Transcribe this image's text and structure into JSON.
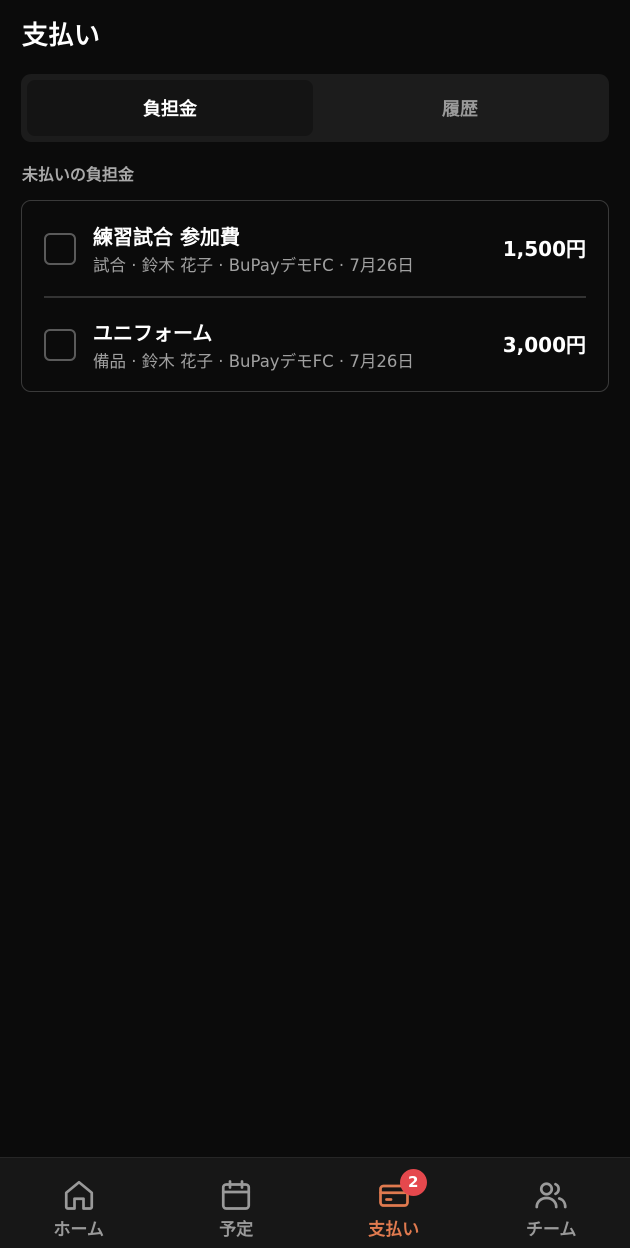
{
  "header": {
    "title": "支払い"
  },
  "tabs": [
    {
      "label": "負担金",
      "active": true
    },
    {
      "label": "履歴",
      "active": false
    }
  ],
  "section": {
    "label": "未払いの負担金"
  },
  "items": [
    {
      "title": "練習試合 参加費",
      "meta": "試合 · 鈴木 花子 · BuPayデモFC · 7月26日",
      "amount": "1,500円",
      "checked": false
    },
    {
      "title": "ユニフォーム",
      "meta": "備品 · 鈴木 花子 · BuPayデモFC · 7月26日",
      "amount": "3,000円",
      "checked": false
    }
  ],
  "nav": {
    "items": [
      {
        "label": "ホーム",
        "icon": "home-icon",
        "active": false
      },
      {
        "label": "予定",
        "icon": "calendar-icon",
        "active": false
      },
      {
        "label": "支払い",
        "icon": "credit-card-icon",
        "active": true,
        "badge": "2"
      },
      {
        "label": "チーム",
        "icon": "users-icon",
        "active": false
      }
    ]
  },
  "colors": {
    "background": "#0b0b0b",
    "accent": "#e07a4f",
    "badge": "#e5484d"
  }
}
